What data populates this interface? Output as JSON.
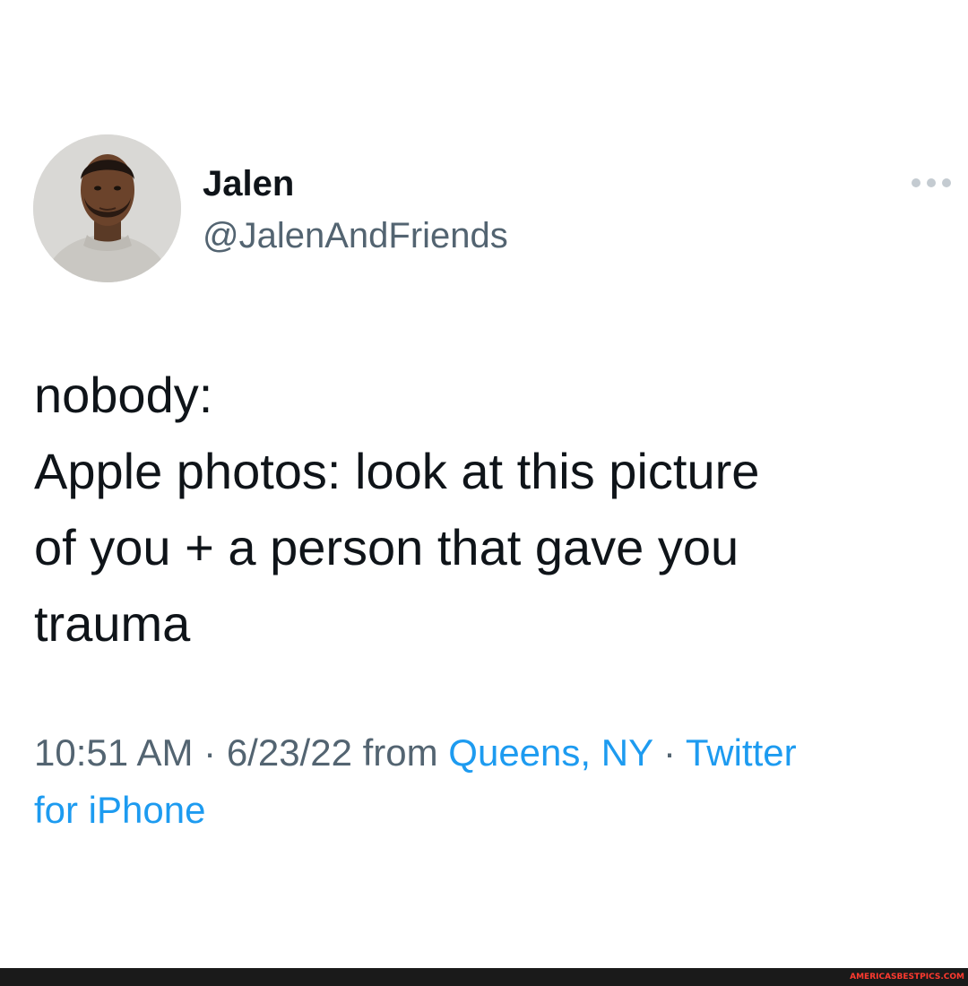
{
  "author": {
    "display_name": "Jalen",
    "handle": "@JalenAndFriends",
    "avatar_icon": "profile-photo"
  },
  "more_icon": "more-horizontal-icon",
  "tweet": {
    "lines": [
      "nobody:",
      "Apple photos: look at this picture",
      "of you + a person that gave you",
      "trauma"
    ]
  },
  "meta": {
    "time": "10:51 AM",
    "separator": "·",
    "date": "6/23/22",
    "from_word": "from",
    "location": "Queens, NY",
    "source_line1": "Twitter",
    "source_line2": "for iPhone"
  },
  "footer": {
    "watermark": "AMERICASBESTPICS.COM"
  },
  "colors": {
    "text": "#0f1419",
    "secondary": "#536471",
    "link": "#1d9bf0",
    "footer_bar": "#1a1a1a",
    "watermark": "#ff3a2f"
  }
}
